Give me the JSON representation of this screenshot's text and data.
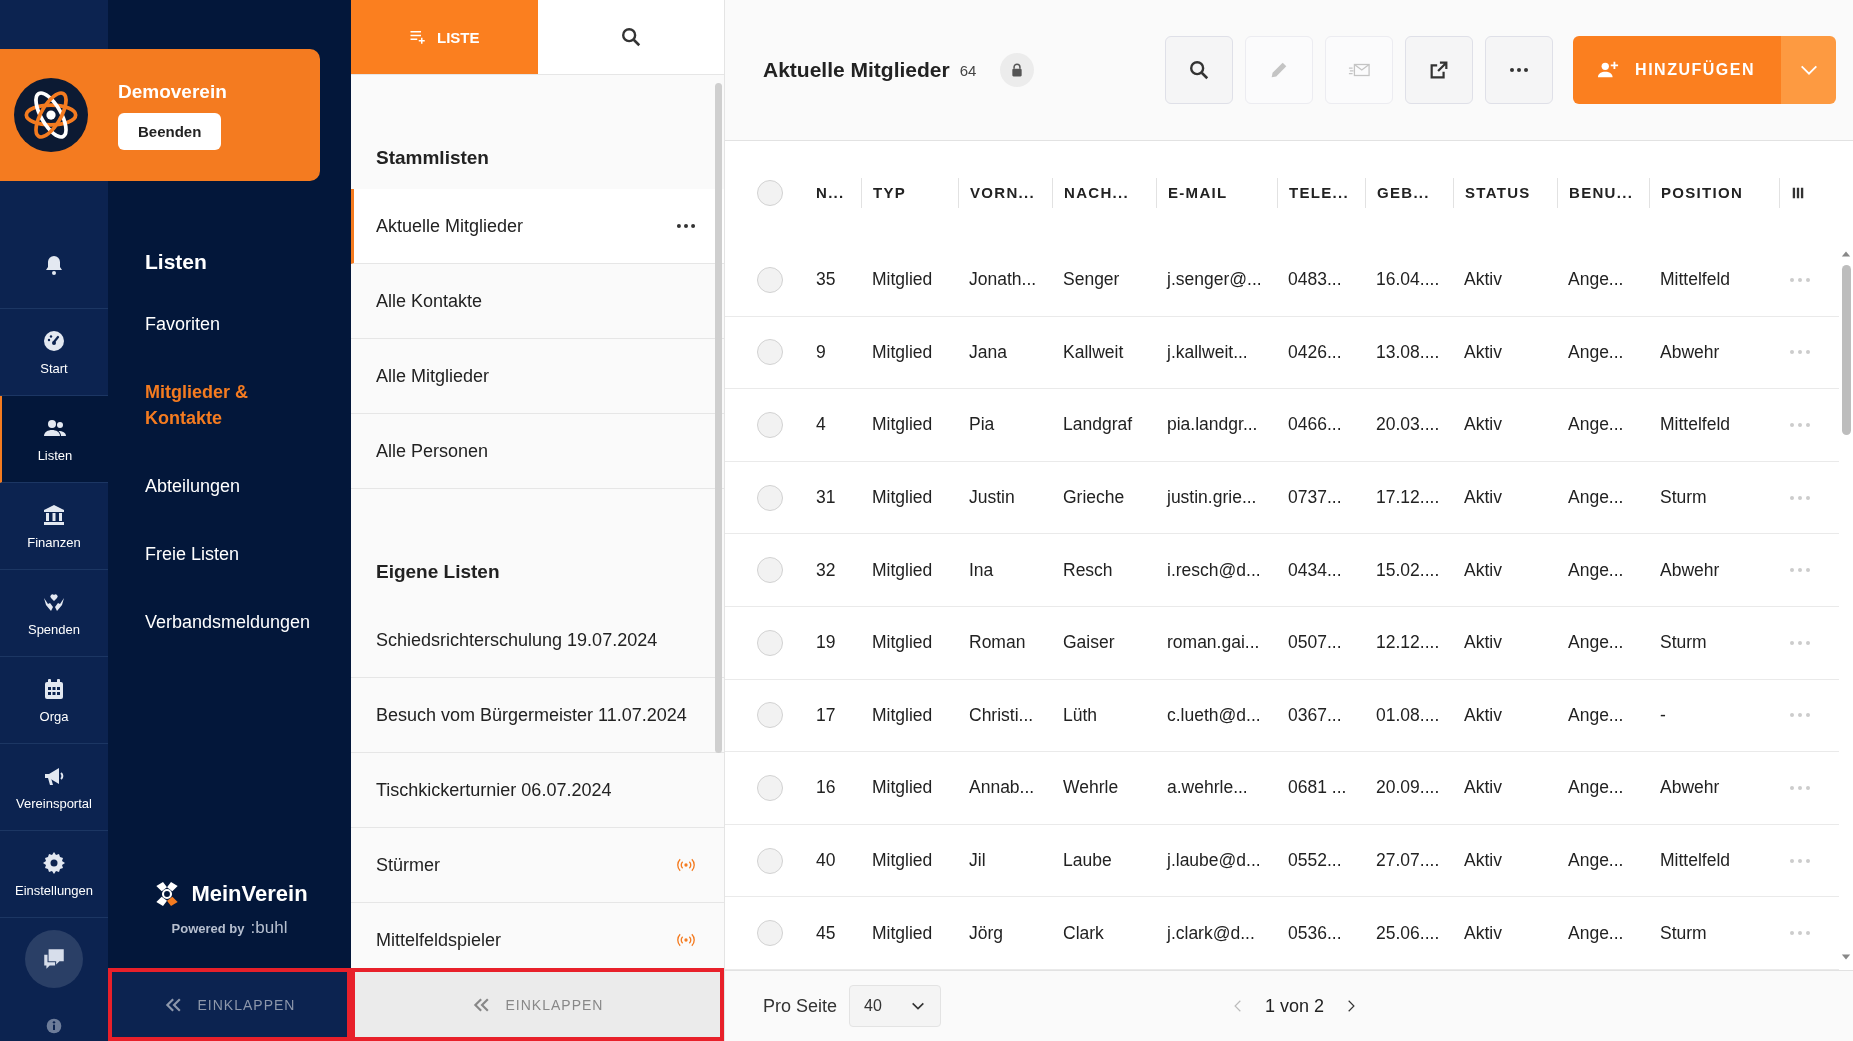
{
  "org": {
    "name": "Demoverein",
    "exit_button": "Beenden"
  },
  "rail": {
    "items": [
      {
        "selected": false
      },
      {
        "label": "Start",
        "selected": false
      },
      {
        "label": "Listen",
        "selected": true
      },
      {
        "label": "Finanzen",
        "selected": false
      },
      {
        "label": "Spenden",
        "selected": false
      },
      {
        "label": "Orga",
        "selected": false
      },
      {
        "label": "Vereinsportal",
        "selected": false
      },
      {
        "label": "Einstellungen",
        "selected": false
      }
    ]
  },
  "nav": {
    "title": "Listen",
    "items": [
      {
        "label": "Favoriten",
        "selected": false
      },
      {
        "label": "Mitglieder & Kontakte",
        "selected": true
      },
      {
        "label": "Abteilungen",
        "selected": false
      },
      {
        "label": "Freie Listen",
        "selected": false
      },
      {
        "label": "Verbandsmeldungen",
        "selected": false
      }
    ],
    "brand": {
      "name": "MeinVerein",
      "powered": "Powered by",
      "by": ":buhl"
    },
    "collapse": {
      "label": "EINKLAPPEN",
      "highlighted": true
    }
  },
  "lists": {
    "tabs": [
      {
        "label": "LISTE",
        "selected": true
      },
      {
        "selected": false
      }
    ],
    "sections": [
      {
        "title": "Stammlisten",
        "items": [
          {
            "label": "Aktuelle Mitglieder",
            "selected": true,
            "shared": false
          },
          {
            "label": "Alle Kontakte",
            "selected": false,
            "shared": false
          },
          {
            "label": "Alle Mitglieder",
            "selected": false,
            "shared": false
          },
          {
            "label": "Alle Personen",
            "selected": false,
            "shared": false
          }
        ]
      },
      {
        "title": "Eigene Listen",
        "items": [
          {
            "label": "Schiedsrichterschulung 19.07.2024",
            "selected": false,
            "shared": false
          },
          {
            "label": "Besuch vom Bürgermeister 11.07.2024",
            "selected": false,
            "shared": false
          },
          {
            "label": "Tischkickerturnier 06.07.2024",
            "selected": false,
            "shared": false
          },
          {
            "label": "Stürmer",
            "selected": false,
            "shared": true
          },
          {
            "label": "Mittelfeldspieler",
            "selected": false,
            "shared": true
          }
        ]
      }
    ],
    "collapse": {
      "label": "EINKLAPPEN",
      "highlighted": true
    }
  },
  "main": {
    "title": "Aktuelle Mitglieder",
    "count": "64",
    "locked": true,
    "toolbar": [
      {
        "disabled": false
      },
      {
        "disabled": true
      },
      {
        "disabled": true
      },
      {
        "disabled": false
      },
      {
        "disabled": false
      }
    ],
    "add_button": "HINZUFÜGEN",
    "table": {
      "all_selected": false,
      "columns": [
        "N...",
        "TYP",
        "VORN...",
        "NACH...",
        "E-MAIL",
        "TELE...",
        "GEB...",
        "STATUS",
        "BENU...",
        "POSITION"
      ],
      "rows": [
        {
          "selected": false,
          "cells": [
            "35",
            "Mitglied",
            "Jonath...",
            "Senger",
            "j.senger@...",
            "0483...",
            "16.04....",
            "Aktiv",
            "Ange...",
            "Mittelfeld"
          ]
        },
        {
          "selected": false,
          "cells": [
            "9",
            "Mitglied",
            "Jana",
            "Kallweit",
            "j.kallweit...",
            "0426...",
            "13.08....",
            "Aktiv",
            "Ange...",
            "Abwehr"
          ]
        },
        {
          "selected": false,
          "cells": [
            "4",
            "Mitglied",
            "Pia",
            "Landgraf",
            "pia.landgr...",
            "0466...",
            "20.03....",
            "Aktiv",
            "Ange...",
            "Mittelfeld"
          ]
        },
        {
          "selected": false,
          "cells": [
            "31",
            "Mitglied",
            "Justin",
            "Grieche",
            "justin.grie...",
            "0737...",
            "17.12....",
            "Aktiv",
            "Ange...",
            "Sturm"
          ]
        },
        {
          "selected": false,
          "cells": [
            "32",
            "Mitglied",
            "Ina",
            "Resch",
            "i.resch@d...",
            "0434...",
            "15.02....",
            "Aktiv",
            "Ange...",
            "Abwehr"
          ]
        },
        {
          "selected": false,
          "cells": [
            "19",
            "Mitglied",
            "Roman",
            "Gaiser",
            "roman.gai...",
            "0507...",
            "12.12....",
            "Aktiv",
            "Ange...",
            "Sturm"
          ]
        },
        {
          "selected": false,
          "cells": [
            "17",
            "Mitglied",
            "Christi...",
            "Lüth",
            "c.lueth@d...",
            "0367...",
            "01.08....",
            "Aktiv",
            "Ange...",
            "-"
          ]
        },
        {
          "selected": false,
          "cells": [
            "16",
            "Mitglied",
            "Annab...",
            "Wehrle",
            "a.wehrle...",
            "0681 ...",
            "20.09....",
            "Aktiv",
            "Ange...",
            "Abwehr"
          ]
        },
        {
          "selected": false,
          "cells": [
            "40",
            "Mitglied",
            "Jil",
            "Laube",
            "j.laube@d...",
            "0552...",
            "27.07....",
            "Aktiv",
            "Ange...",
            "Mittelfeld"
          ]
        },
        {
          "selected": false,
          "cells": [
            "45",
            "Mitglied",
            "Jörg",
            "Clark",
            "j.clark@d...",
            "0536...",
            "25.06....",
            "Aktiv",
            "Ange...",
            "Sturm"
          ]
        }
      ]
    },
    "footer": {
      "per_page_label": "Pro Seite",
      "per_page": "40",
      "page": "1 von 2"
    }
  }
}
